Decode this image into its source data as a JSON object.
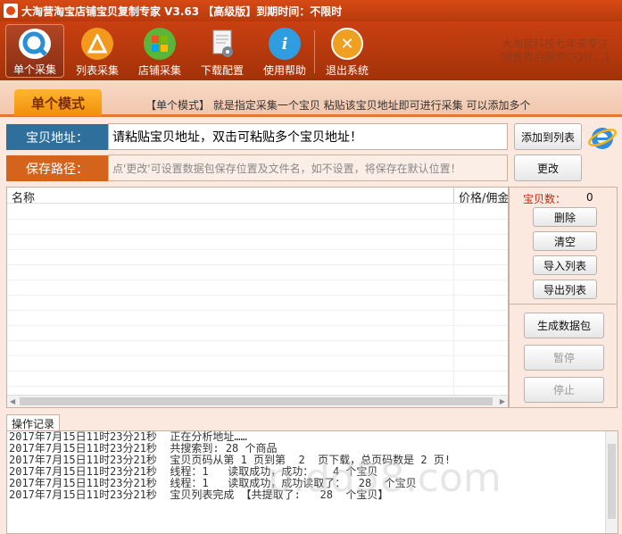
{
  "title": "大淘营淘宝店铺宝贝复制专家 V3.63 【高级版】到期时间：不限时",
  "toolbar": {
    "single": "单个采集",
    "list": "列表采集",
    "shop": "店铺采集",
    "download": "下载配置",
    "help": "使用帮助",
    "exit": "退出系统",
    "ad_line1": "大淘营科技七年来专注",
    "ad_line2": "销售售后服务QQ号：1"
  },
  "mode": {
    "tab": "单个模式",
    "desc": "【单个模式】 就是指定采集一个宝贝 粘贴该宝贝地址即可进行采集 可以添加多个"
  },
  "url_row": {
    "label": "宝贝地址：",
    "value": "请粘贴宝贝地址，双击可粘贴多个宝贝地址！",
    "add_button": "添加到列表"
  },
  "path_row": {
    "label": "保存路径：",
    "placeholder": "点'更改'可设置数据包保存位置及文件名，如不设置，将保存在默认位置！",
    "change_button": "更改"
  },
  "table": {
    "col_name": "名称",
    "col_price": "价格/佣金"
  },
  "side": {
    "count_label": "宝贝数：",
    "count_value": "0",
    "delete": "删除",
    "clear": "清空",
    "import": "导入列表",
    "export": "导出列表",
    "generate": "生成数据包",
    "pause": "暂停",
    "stop": "停止"
  },
  "log": {
    "tab": "操作记录",
    "lines": [
      "2017年7月15日11时23分21秒  正在分析地址……",
      "2017年7月15日11时23分21秒  共搜索到: 28 个商品",
      "2017年7月15日11时23分21秒  宝贝页码从第 1 页到第  2  页下载，总页码数是 2 页!",
      "2017年7月15日11时23分21秒  线程：1   读取成功，成功：   4 个宝贝",
      "2017年7月15日11时23分21秒  线程：1   读取成功，成功读取了：  28  个宝贝",
      "2017年7月15日11时23分21秒  宝贝列表完成 【共提取了:   28  个宝贝】"
    ],
    "watermark": "p.dd58.com"
  },
  "colors": {
    "accent": "#c94012",
    "label_blue": "#2f6f9c",
    "label_orange": "#d4641c"
  }
}
